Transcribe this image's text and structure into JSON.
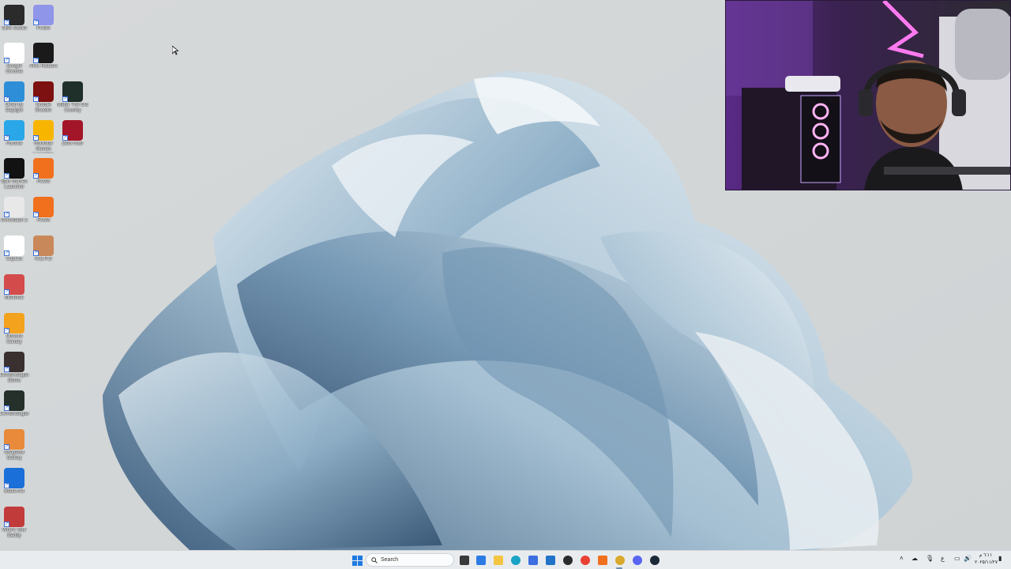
{
  "desktop": {
    "icons": [
      {
        "label": "OBS Studio",
        "icon": "obs-icon",
        "color": "#2b2b2b"
      },
      {
        "label": "PUBG",
        "icon": "pubg-icon",
        "color": "#8f95e8"
      },
      {
        "label": "Google Chrome",
        "icon": "chrome-icon",
        "color": "#ffffff"
      },
      {
        "label": "ARC Raiders",
        "icon": "arc-raiders-icon",
        "color": "#1a1a1a"
      },
      {
        "label": "Dead by Daylight",
        "icon": "dbd-icon",
        "color": "#2e8fd8"
      },
      {
        "label": "Double Shooter",
        "icon": "double-shooter-icon",
        "color": "#7d1010"
      },
      {
        "label": "Mafia: The Old Country",
        "icon": "mafia-icon",
        "color": "#1f2f2a"
      },
      {
        "label": "Fortnite",
        "icon": "fortnite-icon",
        "color": "#2aa7e8"
      },
      {
        "label": "Rockstar Games Launcher",
        "icon": "rockstar-icon",
        "color": "#f7b500"
      },
      {
        "label": "Zero Hour",
        "icon": "zero-hour-icon",
        "color": "#a3162a"
      },
      {
        "label": "Epic Games Launcher",
        "icon": "epic-games-icon",
        "color": "#121212"
      },
      {
        "label": "FiveM",
        "icon": "fivem-icon",
        "color": "#f0701e"
      },
      {
        "label": "Overwatch 2",
        "icon": "overwatch-icon",
        "color": "#e8e8e8"
      },
      {
        "label": "FiveM",
        "icon": "fivem-icon",
        "color": "#f0701e"
      },
      {
        "label": "CapCut",
        "icon": "capcut-icon",
        "color": "#ffffff"
      },
      {
        "label": "R.E.P.O",
        "icon": "repo-icon",
        "color": "#c9885a"
      },
      {
        "label": "Mistletoe",
        "icon": "mistletoe-icon",
        "color": "#d44b4b"
      },
      {
        "label": "Discord Canary",
        "icon": "discord-icon",
        "color": "#f3a21e"
      },
      {
        "label": "Demonologist Demo",
        "icon": "demonologist-icon",
        "color": "#3a3030"
      },
      {
        "label": "Demonologist",
        "icon": "demonologist-icon",
        "color": "#25302a"
      },
      {
        "label": "Snapshot Gallery",
        "icon": "gallery-icon",
        "color": "#e88a3a"
      },
      {
        "label": "Battle.net",
        "icon": "battlenet-icon",
        "color": "#1b6fd8"
      },
      {
        "label": "Who's Your Daddy",
        "icon": "game-icon",
        "color": "#c23b3b"
      }
    ]
  },
  "taskbar": {
    "search_placeholder": "Search",
    "pinned": [
      {
        "icon": "task-view-icon",
        "color": "#3a3a3a"
      },
      {
        "icon": "edge-copilot-icon",
        "color": "#2c7be5"
      },
      {
        "icon": "file-explorer-icon",
        "color": "#f4c542"
      },
      {
        "icon": "edge-icon",
        "color": "#1aa3c7"
      },
      {
        "icon": "store-icon",
        "color": "#3d6fe0"
      },
      {
        "icon": "outlook-icon",
        "color": "#2173c8"
      },
      {
        "icon": "obs-icon",
        "color": "#2b2b2b"
      },
      {
        "icon": "chrome-icon",
        "color": "#e94235"
      },
      {
        "icon": "fivem-icon",
        "color": "#f0701e"
      },
      {
        "icon": "chrome-canary-icon",
        "color": "#d9a92c"
      },
      {
        "icon": "discord-icon",
        "color": "#5865f2"
      },
      {
        "icon": "steam-icon",
        "color": "#1b2838"
      }
    ],
    "tray": {
      "keyboard_language": "ع",
      "time": "٦:١١ م",
      "date": "٢٠٢٥/١١/٢٧"
    }
  }
}
